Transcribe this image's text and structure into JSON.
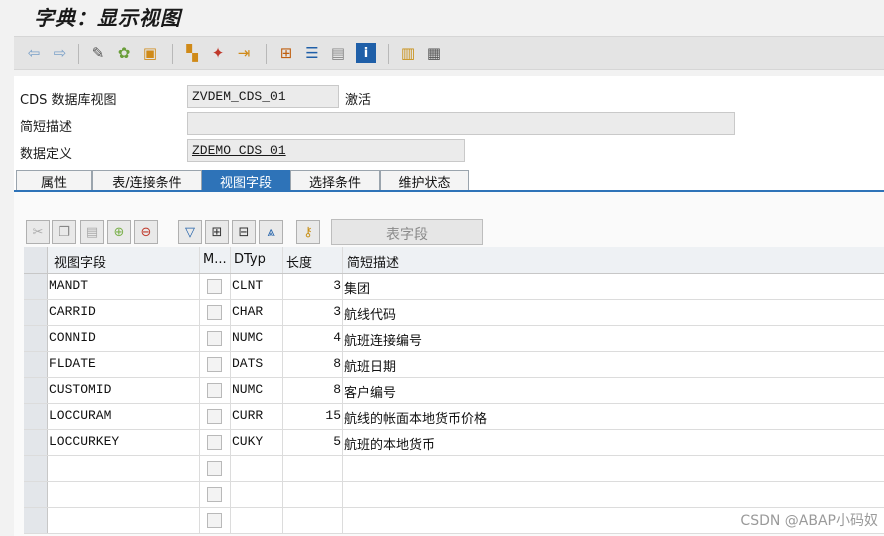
{
  "window": {
    "title": "字典：显示视图"
  },
  "toolbar": {
    "icons": [
      "back-icon",
      "forward-icon",
      "edit-display-icon",
      "other-object-icon",
      "check-icon",
      "activate-icon",
      "where-used-icon",
      "navigation-icon",
      "object-list-icon",
      "hierarchy-icon",
      "documentation-icon",
      "info-icon",
      "columns-icon",
      "table-icon"
    ]
  },
  "header": {
    "cds_view_label": "CDS 数据库视图",
    "cds_view_value": "ZVDEM_CDS_01",
    "status": "激活",
    "short_desc_label": "简短描述",
    "short_desc_value": "",
    "data_def_label": "数据定义",
    "data_def_value": "ZDEMO_CDS_01"
  },
  "tabs": [
    {
      "label": "属性",
      "active": false
    },
    {
      "label": "表/连接条件",
      "active": false
    },
    {
      "label": "视图字段",
      "active": true
    },
    {
      "label": "选择条件",
      "active": false
    },
    {
      "label": "维护状态",
      "active": false
    }
  ],
  "grid_toolbar": {
    "table_field_button": "表字段"
  },
  "grid": {
    "columns": [
      "视图字段",
      "M...",
      "DTyp",
      "长度",
      "简短描述"
    ],
    "rows": [
      {
        "field": "MANDT",
        "dtype": "CLNT",
        "length": "3",
        "desc": "集团"
      },
      {
        "field": "CARRID",
        "dtype": "CHAR",
        "length": "3",
        "desc": "航线代码"
      },
      {
        "field": "CONNID",
        "dtype": "NUMC",
        "length": "4",
        "desc": "航班连接编号"
      },
      {
        "field": "FLDATE",
        "dtype": "DATS",
        "length": "8",
        "desc": "航班日期"
      },
      {
        "field": "CUSTOMID",
        "dtype": "NUMC",
        "length": "8",
        "desc": "客户编号"
      },
      {
        "field": "LOCCURAM",
        "dtype": "CURR",
        "length": "15",
        "desc": "航线的帐面本地货币价格"
      },
      {
        "field": "LOCCURKEY",
        "dtype": "CUKY",
        "length": "5",
        "desc": "航班的本地货币"
      },
      {
        "field": "",
        "dtype": "",
        "length": "",
        "desc": ""
      },
      {
        "field": "",
        "dtype": "",
        "length": "",
        "desc": ""
      },
      {
        "field": "",
        "dtype": "",
        "length": "",
        "desc": ""
      }
    ]
  },
  "watermark": "CSDN @ABAP小码奴",
  "colors": {
    "tab_active": "#2e73b8",
    "background": "#f2f2f2"
  }
}
